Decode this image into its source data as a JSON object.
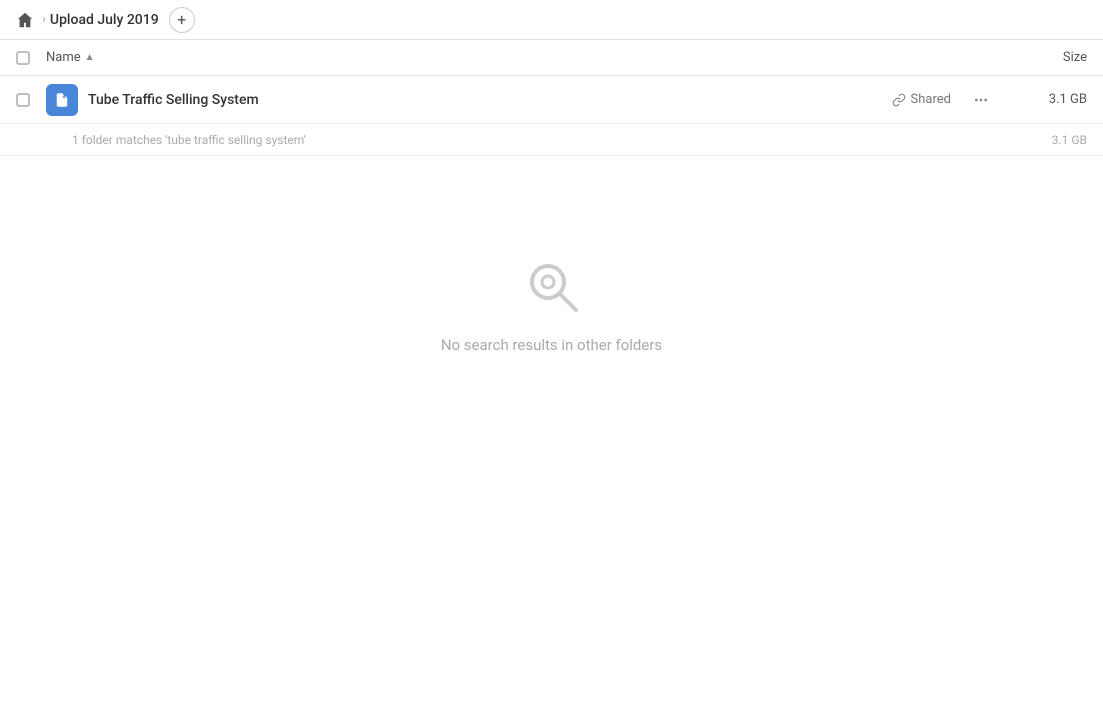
{
  "topbar": {
    "home_icon": "home",
    "breadcrumb": "Upload July 2019",
    "add_button": "+"
  },
  "columns": {
    "name_label": "Name",
    "sort_indicator": "▲",
    "size_label": "Size"
  },
  "file_row": {
    "name": "Tube Traffic Selling System",
    "shared_label": "Shared",
    "size": "3.1 GB",
    "more_icon": "···"
  },
  "sub_row": {
    "text": "1 folder matches 'tube traffic selling system'",
    "size": "3.1 GB"
  },
  "empty_state": {
    "message": "No search results in other folders"
  }
}
